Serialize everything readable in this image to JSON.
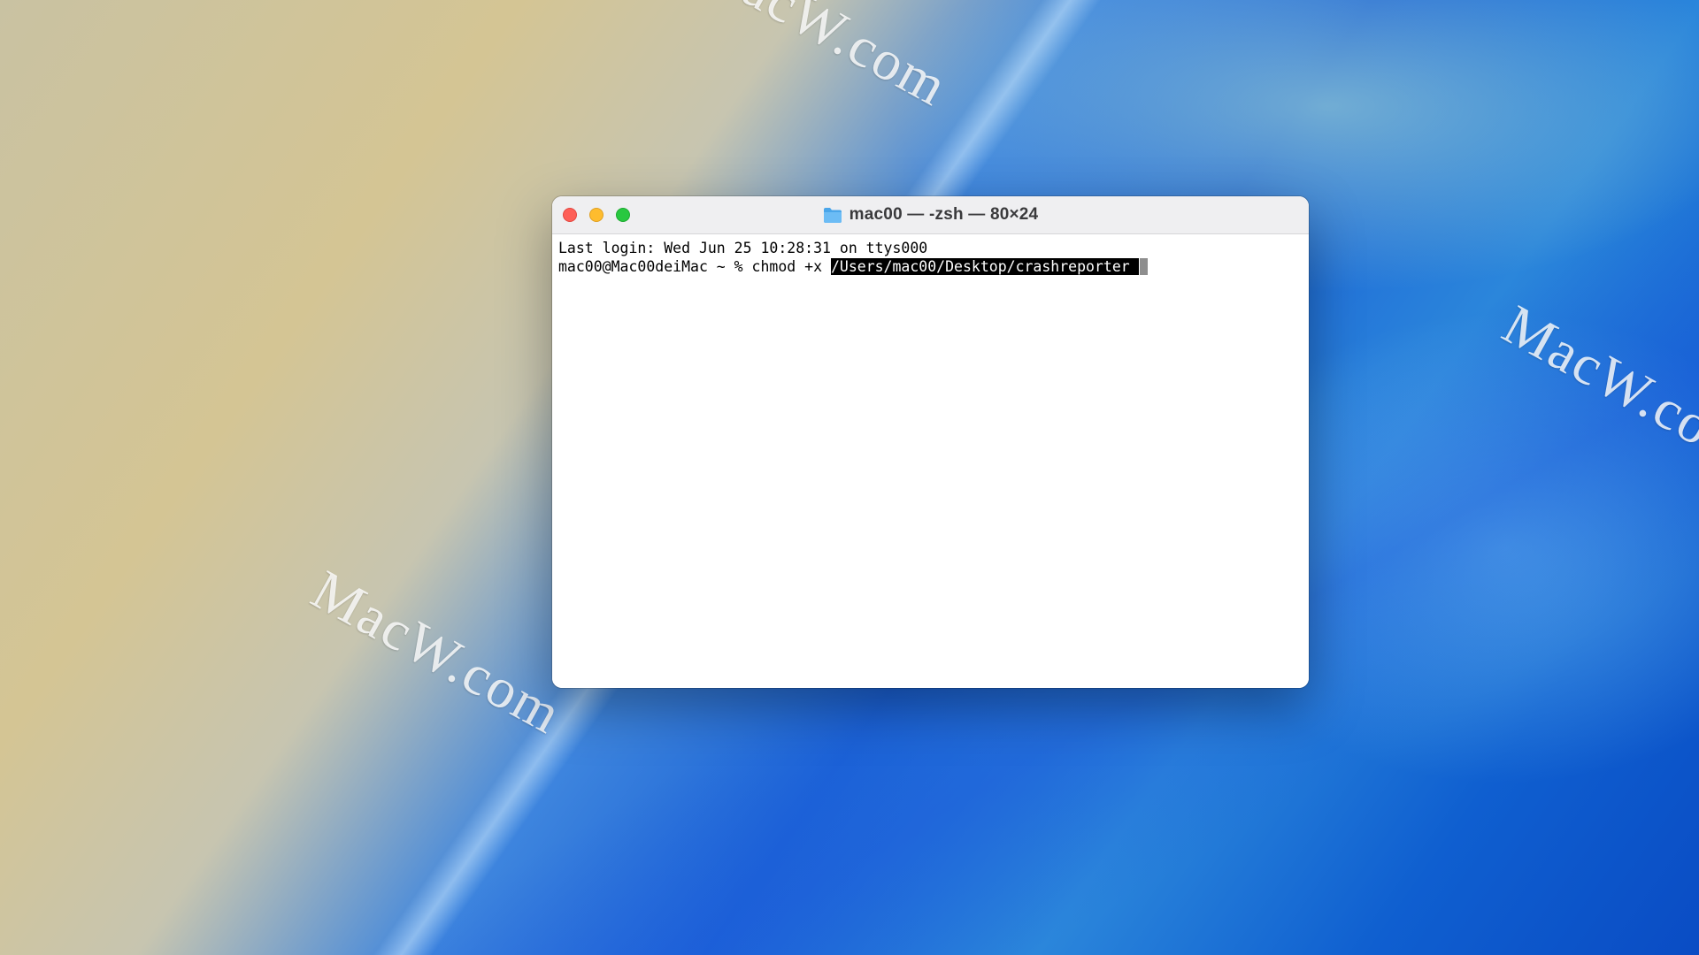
{
  "window": {
    "title": "mac00 — -zsh — 80×24",
    "folder_icon": "folder-icon"
  },
  "terminal": {
    "last_login": "Last login: Wed Jun 25 10:28:31 on ttys000",
    "prompt": "mac00@Mac00deiMac ~ % chmod +x ",
    "selected_path": "/Users/mac00/Desktop/crashreporter ",
    "selection_color": "#000000",
    "cursor_color": "#8e8e8e"
  },
  "desktop": {
    "watermarks": [
      "MacW.com",
      "MacW.com",
      "MacW.com"
    ]
  },
  "colors": {
    "close": "#fe5f57",
    "minimize": "#febc2e",
    "zoom": "#28c840"
  }
}
